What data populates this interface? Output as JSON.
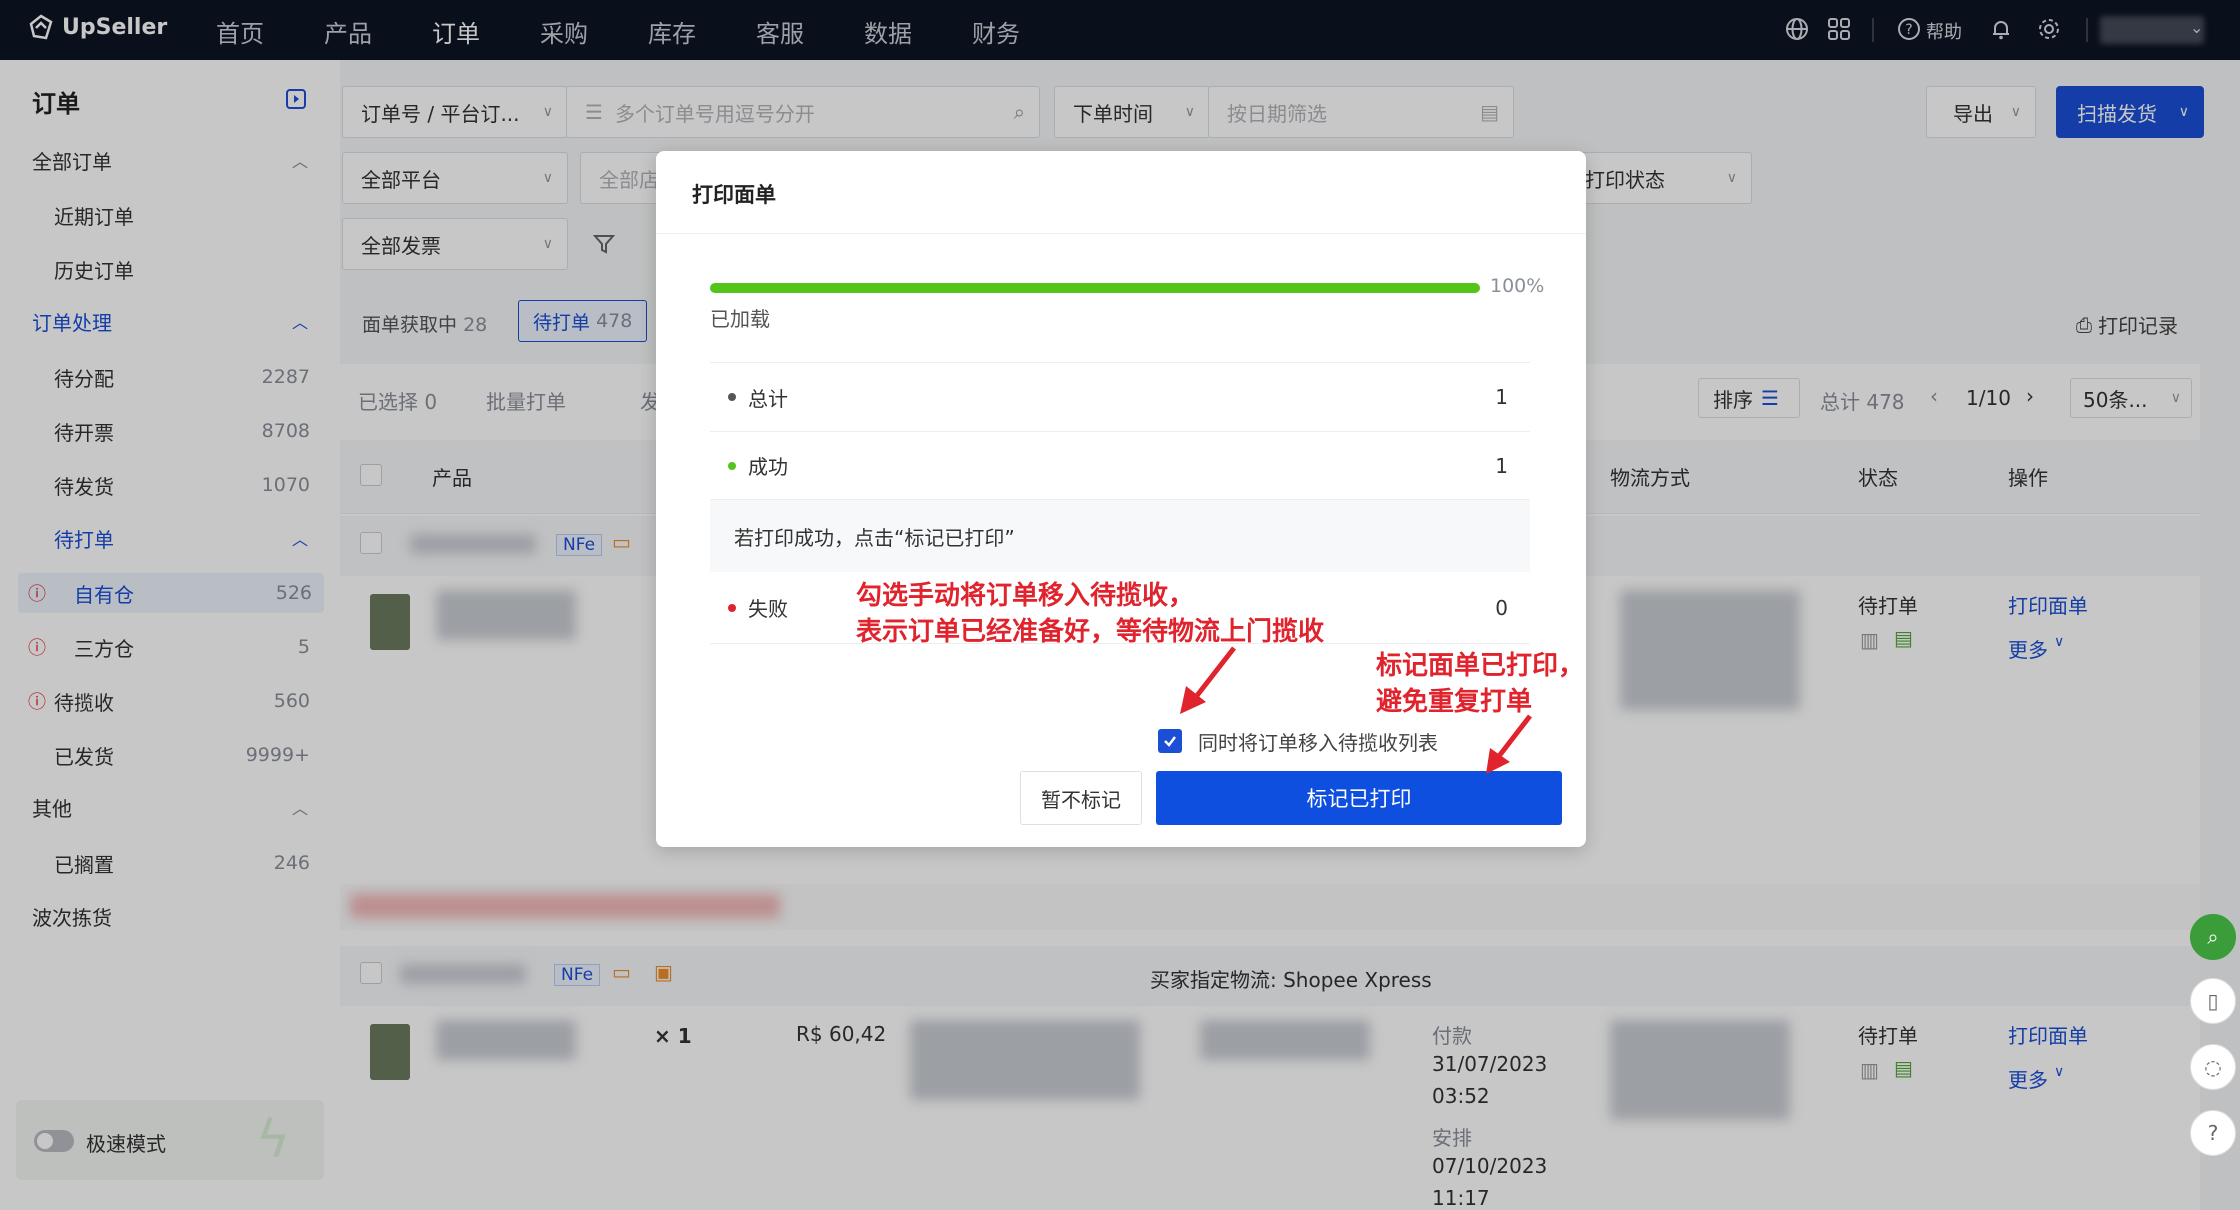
{
  "topnav": {
    "brand": "UpSeller",
    "items": [
      "首页",
      "产品",
      "订单",
      "采购",
      "库存",
      "客服",
      "数据",
      "财务"
    ],
    "active_index": 2,
    "help_label": "帮助"
  },
  "sidebar": {
    "title": "订单",
    "items": [
      {
        "label": "全部订单",
        "count": ""
      },
      {
        "label": "近期订单",
        "count": ""
      },
      {
        "label": "历史订单",
        "count": ""
      },
      {
        "label": "订单处理",
        "count": ""
      },
      {
        "label": "待分配",
        "count": "2287"
      },
      {
        "label": "待开票",
        "count": "8708"
      },
      {
        "label": "待发货",
        "count": "1070"
      },
      {
        "label": "待打单",
        "count": ""
      },
      {
        "label": "自有仓",
        "count": "526"
      },
      {
        "label": "三方仓",
        "count": "5"
      },
      {
        "label": "待揽收",
        "count": "560"
      },
      {
        "label": "已发货",
        "count": "9999+"
      },
      {
        "label": "其他",
        "count": ""
      },
      {
        "label": "已搁置",
        "count": "246"
      },
      {
        "label": "波次拣货",
        "count": ""
      }
    ],
    "speed_mode": "极速模式"
  },
  "filters": {
    "order_type": "订单号 / 平台订...",
    "search_placeholder": "多个订单号用逗号分开",
    "time_type": "下单时间",
    "date_placeholder": "按日期筛选",
    "export": "导出",
    "scan_ship": "扫描发货",
    "platform": "全部平台",
    "store": "全部店",
    "print_status": "打印状态",
    "invoice": "全部发票"
  },
  "tabs": {
    "fetching_label": "面单获取中",
    "fetching_count": "28",
    "pending_label": "待打单",
    "pending_count": "478",
    "print_log": "打印记录"
  },
  "toolbar": {
    "selected": "已选择 0",
    "bulk": "批量打单",
    "ship_trunc": "发",
    "sort": "排序",
    "total": "总计 478",
    "page": "1/10",
    "page_size": "50条..."
  },
  "table": {
    "col_product": "产品",
    "col_logistics": "物流方式",
    "col_status": "状态",
    "col_actions": "操作",
    "nfe": "NFe",
    "row1_status": "待打单",
    "row1_print": "打印面单",
    "row1_more": "更多",
    "buyer_logistics": "买家指定物流: Shopee Xpress",
    "row2_qty": "× 1",
    "row2_price": "R$ 60,42",
    "row2_pay_label": "付款",
    "row2_pay_date": "31/07/2023",
    "row2_pay_time": "03:52",
    "row2_arrange_label": "安排",
    "row2_arrange_date": "07/10/2023",
    "row2_arrange_time": "11:17",
    "row2_status": "待打单",
    "row2_print": "打印面单",
    "row2_more": "更多"
  },
  "modal": {
    "title": "打印面单",
    "progress": 1.0,
    "progress_label": "100%",
    "loaded": "已加载",
    "total_label": "总计",
    "total_value": "1",
    "success_label": "成功",
    "success_value": "1",
    "hint": "若打印成功，点击“标记已打印”",
    "fail_label": "失败",
    "fail_value": "0",
    "checkbox_label": "同时将订单移入待揽收列表",
    "checkbox_checked": true,
    "btn_later": "暂不标记",
    "btn_mark": "标记已打印"
  },
  "annotations": {
    "left_line1": "勾选手动将订单移入待揽收，",
    "left_line2": "表示订单已经准备好，等待物流上门揽收",
    "right_line1": "标记面单已打印，",
    "right_line2": "避免重复打单"
  },
  "colors": {
    "nav_bg": "#0c1423",
    "primary": "#1a4fd6",
    "progress": "#52c41a",
    "annotation": "#e0232c"
  }
}
